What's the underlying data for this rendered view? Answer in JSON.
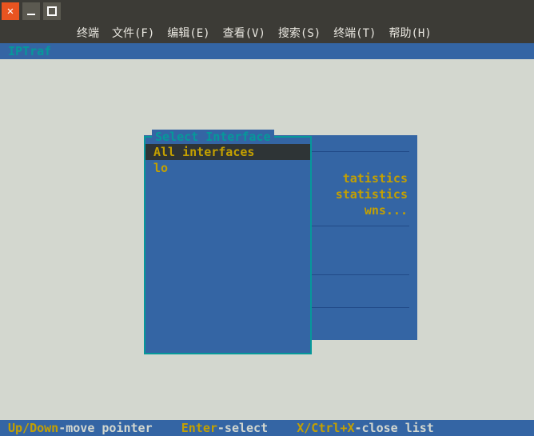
{
  "window": {
    "menu": {
      "terminal": "终端",
      "file": "文件(F)",
      "edit": "编辑(E)",
      "view": "查看(V)",
      "search": "搜索(S)",
      "term": "终端(T)",
      "help": "帮助(H)"
    }
  },
  "app": {
    "title": "IPTraf"
  },
  "interface_panel": {
    "title": "Select Interface",
    "items": [
      "All interfaces",
      "lo"
    ],
    "selected_index": 0
  },
  "background_panel": {
    "lines": [
      "tatistics",
      "statistics",
      "wns..."
    ]
  },
  "statusbar": {
    "k1": "Up/Down",
    "t1": "-move pointer",
    "k2": "Enter",
    "t2": "-select",
    "k3": "X/Ctrl+X",
    "t3": "-close list"
  }
}
